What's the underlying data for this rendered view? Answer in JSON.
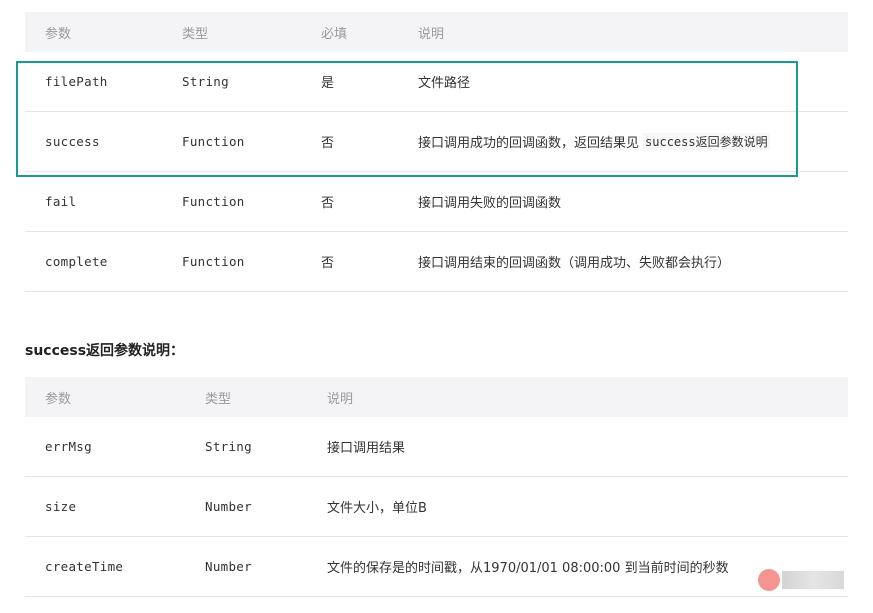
{
  "params_table": {
    "headers": [
      "参数",
      "类型",
      "必填",
      "说明"
    ],
    "rows": [
      {
        "name": "filePath",
        "type": "String",
        "required": "是",
        "desc": "文件路径",
        "desc_code": ""
      },
      {
        "name": "success",
        "type": "Function",
        "required": "否",
        "desc": "接口调用成功的回调函数，返回结果见",
        "desc_code": "success返回参数说明"
      },
      {
        "name": "fail",
        "type": "Function",
        "required": "否",
        "desc": "接口调用失败的回调函数",
        "desc_code": ""
      },
      {
        "name": "complete",
        "type": "Function",
        "required": "否",
        "desc": "接口调用结束的回调函数（调用成功、失败都会执行）",
        "desc_code": ""
      }
    ]
  },
  "section_title": "success返回参数说明：",
  "return_table": {
    "headers": [
      "参数",
      "类型",
      "说明"
    ],
    "rows": [
      {
        "name": "errMsg",
        "type": "String",
        "desc": "接口调用结果"
      },
      {
        "name": "size",
        "type": "Number",
        "desc": "文件大小，单位B"
      },
      {
        "name": "createTime",
        "type": "Number",
        "desc": "文件的保存是的时间戳，从1970/01/01 08:00:00 到当前时间的秒数"
      }
    ]
  },
  "colors": {
    "highlight_border": "#1a9a94",
    "header_bg": "#f4f4f6",
    "header_text": "#9a9a9a",
    "body_text": "#333333"
  }
}
